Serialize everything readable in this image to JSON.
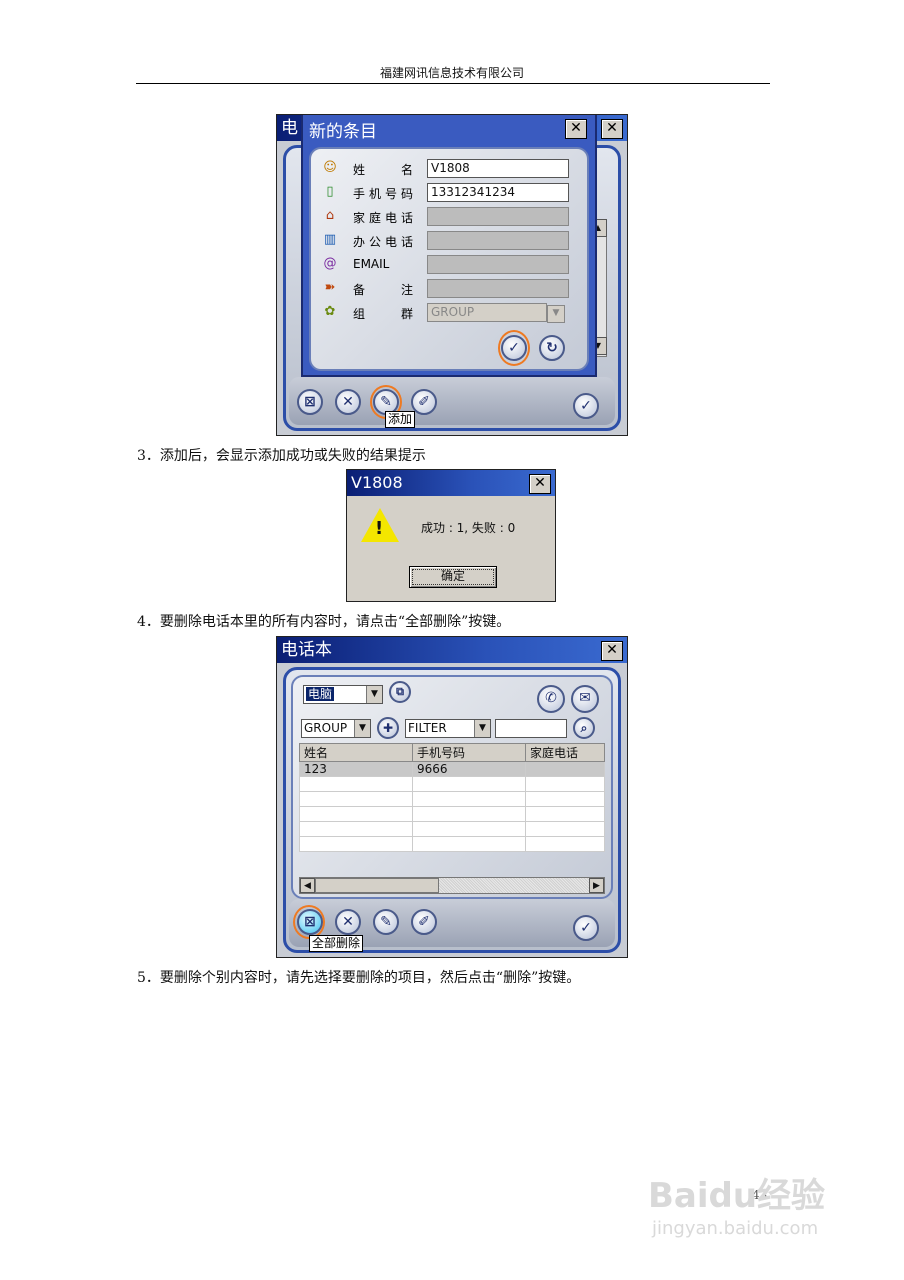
{
  "header": {
    "text": "福建网讯信息技术有限公司"
  },
  "dialog1": {
    "title_prefix": "电",
    "title": "新的条目",
    "fields": [
      {
        "label": "姓　名",
        "value": "V1808",
        "icon": "person-icon",
        "glyph": "☺",
        "filled": true
      },
      {
        "label": "手机号码",
        "value": "13312341234",
        "icon": "mobile-phone-icon",
        "glyph": "▯",
        "filled": true
      },
      {
        "label": "家庭电话",
        "value": "",
        "icon": "home-icon",
        "glyph": "⌂",
        "filled": false
      },
      {
        "label": "办公电话",
        "value": "",
        "icon": "office-building-icon",
        "glyph": "▥",
        "filled": false
      },
      {
        "label": "EMAIL",
        "value": "",
        "icon": "at-sign-icon",
        "glyph": "@",
        "filled": false
      },
      {
        "label": "备　注",
        "value": "",
        "icon": "signpost-icon",
        "glyph": "➽",
        "filled": false
      },
      {
        "label": "组　群",
        "value": "GROUP",
        "icon": "group-icon",
        "glyph": "✿",
        "filled": false
      }
    ],
    "tooltip": "添加"
  },
  "step3": "3．添加后，会显示添加成功或失败的结果提示",
  "dialog2": {
    "title": "V1808",
    "message": "成功 : 1, 失败 : 0",
    "ok_label": "确定",
    "icon": "warning-icon"
  },
  "step4": "4．要删除电话本里的所有内容时，请点击“全部删除”按键。",
  "phonebook": {
    "title": "电话本",
    "source_select": "电脑",
    "group_select": "GROUP",
    "filter_select": "FILTER",
    "search_value": "",
    "columns": [
      "姓名",
      "手机号码",
      "家庭电话"
    ],
    "rows": [
      [
        "123",
        "9666",
        ""
      ],
      [
        "",
        "",
        ""
      ],
      [
        "",
        "",
        ""
      ],
      [
        "",
        "",
        ""
      ],
      [
        "",
        "",
        ""
      ],
      [
        "",
        "",
        ""
      ]
    ],
    "tooltip": "全部删除"
  },
  "step5": "5．要删除个别内容时，请先选择要删除的项目，然后点击“删除”按键。",
  "page_number": "43",
  "watermark": {
    "brand": "Baidu经验",
    "url": "jingyan.baidu.com"
  },
  "colors": {
    "title_bar": "#0a1e74",
    "frame_border": "#2c4ea8",
    "highlight_ring": "#ee7a22"
  }
}
